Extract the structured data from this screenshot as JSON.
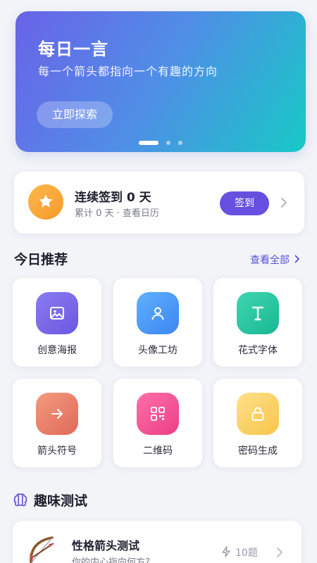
{
  "banner": {
    "title": "每日一言",
    "subtitle": "每一个箭头都指向一个有趣的方向",
    "button_label": "立即探索",
    "slide_count": 3,
    "active_slide": 1
  },
  "checkin": {
    "title": "连续签到 0 天",
    "subtitle": "累计 0 天 · 查看日历",
    "button_label": "签到",
    "icon": "star-icon"
  },
  "recommend": {
    "title": "今日推荐",
    "see_all": "查看全部",
    "tiles": [
      {
        "label": "创意海报",
        "icon": "image-icon",
        "colors": [
          "#8a7cf0",
          "#6a58e0"
        ]
      },
      {
        "label": "头像工坊",
        "icon": "user-icon",
        "colors": [
          "#5fb0ff",
          "#3d86f0"
        ]
      },
      {
        "label": "花式字体",
        "icon": "text-icon",
        "colors": [
          "#3fd6b0",
          "#19b894"
        ]
      },
      {
        "label": "箭头符号",
        "icon": "arrow-right-icon",
        "colors": [
          "#f29a7e",
          "#e06a5a"
        ]
      },
      {
        "label": "二维码",
        "icon": "qrcode-icon",
        "colors": [
          "#ff6fa8",
          "#ec3f86"
        ]
      },
      {
        "label": "密码生成",
        "icon": "lock-icon",
        "colors": [
          "#ffe08a",
          "#f7c54a"
        ]
      }
    ]
  },
  "fun": {
    "title": "趣味测试",
    "icon": "brain-icon"
  },
  "test_card": {
    "title": "性格箭头测试",
    "subtitle": "你的内心指向何方?",
    "count": "10题",
    "thumb_icon": "bow-arrow-icon"
  },
  "colors": {
    "accent": "#6750e0",
    "link": "#5a4fd6",
    "background": "#f3f4f8"
  }
}
